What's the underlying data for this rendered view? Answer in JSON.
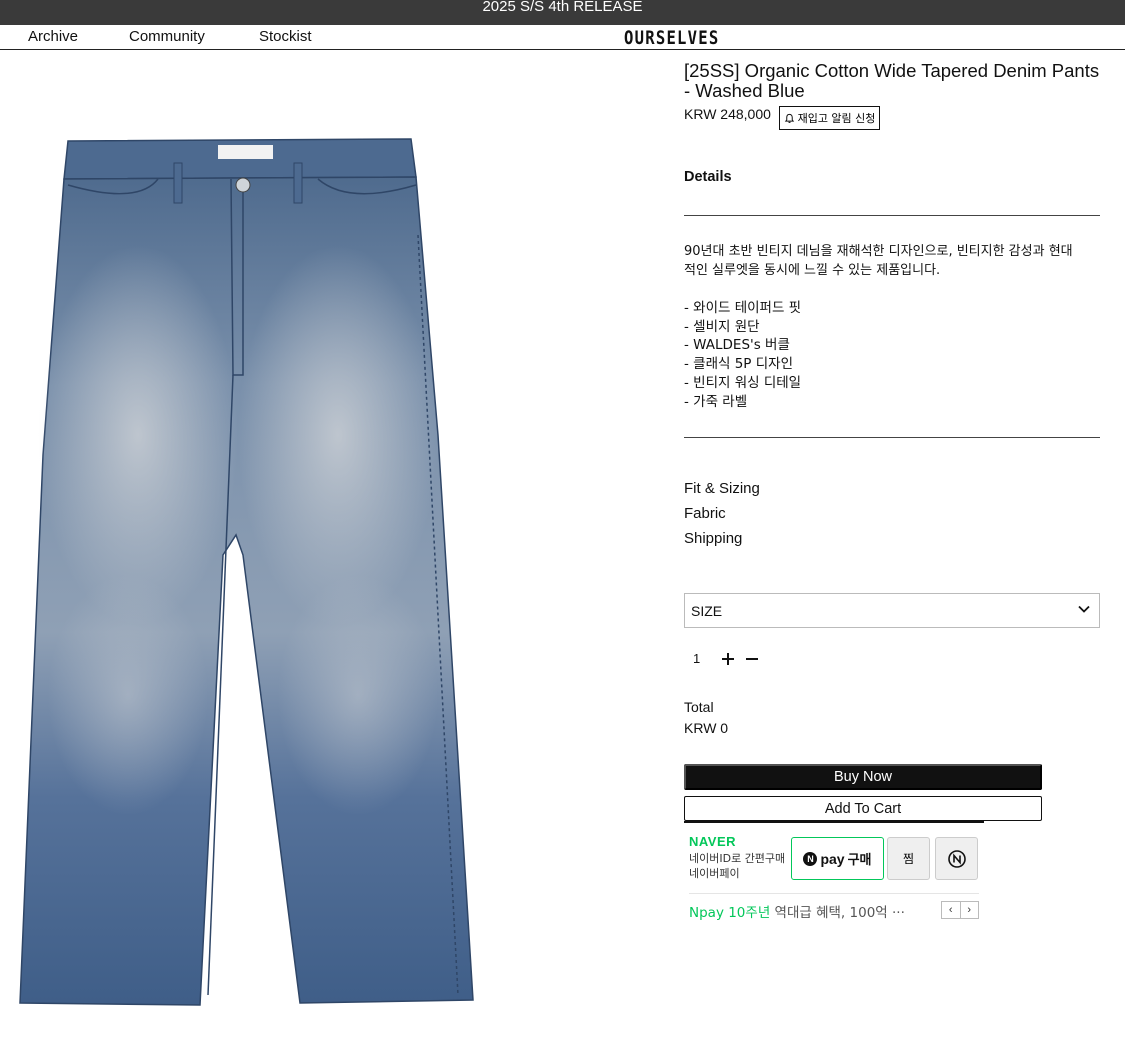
{
  "banner": {
    "text": "2025 S/S 4th RELEASE"
  },
  "nav": {
    "links": [
      "Archive",
      "Community",
      "Stockist"
    ],
    "logo": "OURSELVES"
  },
  "product": {
    "title": "[25SS] Organic Cotton Wide Tapered Denim Pants - Washed Blue",
    "price": "KRW 248,000",
    "restock_label": "재입고 알림 신청",
    "details_label": "Details",
    "description": "90년대 초반 빈티지 데님을 재해석한 디자인으로, 빈티지한 감성과 현대\n적인 실루엣을 동시에 느낄 수 있는 제품입니다.",
    "features": [
      "- 와이드 테이퍼드 핏",
      "- 셀비지 원단",
      "- WALDES's 버클",
      "- 클래식 5P 디자인",
      "- 빈티지 워싱 디테일",
      "- 가죽 라벨"
    ],
    "accordion": [
      "Fit & Sizing",
      "Fabric",
      "Shipping"
    ],
    "size_select": "SIZE",
    "quantity": "1",
    "total_label": "Total",
    "total_value": "KRW 0",
    "buy_now": "Buy Now",
    "add_to_cart": "Add To Cart",
    "denim_color": "#6f86a3"
  },
  "naver": {
    "brand": "NAVER",
    "sub_line1": "네이버ID로 간편구매",
    "sub_line2": "네이버페이",
    "npay_n": "N",
    "npay_pay": "pay",
    "npay_buy": "구매",
    "jjim": "찜",
    "promo_green": "Npay 10주년",
    "promo_gray": " 역대급 혜택, 100억 ···",
    "brand_color": "#03c75a"
  }
}
